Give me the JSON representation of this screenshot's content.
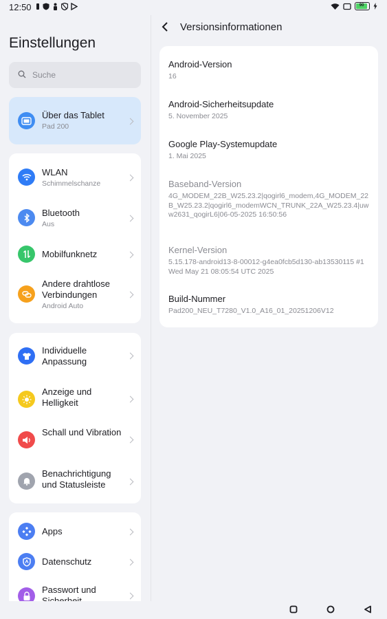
{
  "status": {
    "time": "12:50",
    "battery_level": "90"
  },
  "left": {
    "title": "Einstellungen",
    "search_placeholder": "Suche",
    "highlight": {
      "label": "Über das Tablet",
      "sub": "Pad 200",
      "icon": "tablet-icon"
    },
    "group1": [
      {
        "label": "WLAN",
        "sub": "Schimmelschanze",
        "icon": "wifi-icon",
        "color": "#2f7cf6"
      },
      {
        "label": "Bluetooth",
        "sub": "Aus",
        "icon": "bluetooth-icon",
        "color": "#4c8af0"
      },
      {
        "label": "Mobilfunknetz",
        "sub": "",
        "icon": "mobile-data-icon",
        "color": "#37c66b"
      },
      {
        "label": "Andere drahtlose Verbindungen",
        "sub": "Android Auto",
        "icon": "connections-icon",
        "color": "#f6a11d"
      }
    ],
    "group2": [
      {
        "label": "Individuelle Anpassung",
        "icon": "shirt-icon",
        "color": "#2f6ff4"
      },
      {
        "label": "Anzeige und Helligkeit",
        "icon": "sun-icon",
        "color": "#f5c91e"
      },
      {
        "label": "Schall und Vibration",
        "icon": "speaker-icon",
        "color": "#f04b4b"
      },
      {
        "label": "Benachrichtigung und Statusleiste",
        "icon": "bell-icon",
        "color": "#a0a4ae"
      }
    ],
    "group3": [
      {
        "label": "Apps",
        "icon": "apps-icon",
        "color": "#4c7ef2"
      },
      {
        "label": "Datenschutz",
        "icon": "shield-icon",
        "color": "#4c7ef2"
      },
      {
        "label": "Passwort und Sicherheit",
        "icon": "lock-icon",
        "color": "#a25ee8"
      }
    ]
  },
  "right": {
    "title": "Versionsinformationen",
    "items": [
      {
        "label": "Android-Version",
        "value": "16"
      },
      {
        "label": "Android-Sicherheitsupdate",
        "value": "5. November 2025"
      },
      {
        "label": "Google Play-Systemupdate",
        "value": "1. Mai 2025"
      },
      {
        "label": "Baseband-Version",
        "value": "4G_MODEM_22B_W25.23.2|qogirl6_modem,4G_MODEM_22B_W25.23.2|qogirl6_modemWCN_TRUNK_22A_W25.23.4|uww2631_qogirL6|06-05-2025 16:50:56"
      },
      {
        "label": "Kernel-Version",
        "value": "5.15.178-android13-8-00012-g4ea0fcb5d130-ab13530115 #1 Wed May 21 08:05:54 UTC 2025"
      },
      {
        "label": "Build-Nummer",
        "value": "Pad200_NEU_T7280_V1.0_A16_01_20251206V12"
      }
    ]
  }
}
